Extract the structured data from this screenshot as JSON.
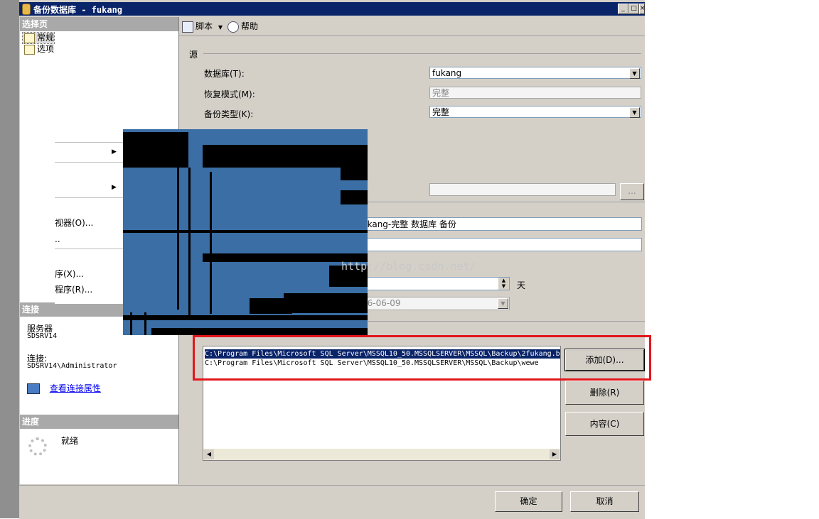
{
  "window": {
    "title": "备份数据库 - fukang",
    "btn_min": "_",
    "btn_max": "□",
    "btn_close": "×"
  },
  "left": {
    "select_page": "选择页",
    "nav": [
      {
        "label": "常规"
      },
      {
        "label": "选项"
      }
    ],
    "connection": "连接",
    "server_label": "服务器",
    "server_value": "SDSRV14",
    "conn_label": "连接:",
    "conn_value": "SDSRV14\\Administrator",
    "view_conn_props": "查看连接属性",
    "progress": "进度",
    "ready": "就绪"
  },
  "toolbar": {
    "script": "脚本",
    "help": "帮助"
  },
  "source": {
    "group": "源",
    "database_label": "数据库(T):",
    "database_value": "fukang",
    "recovery_label": "恢复模式(M):",
    "recovery_value": "完整",
    "backup_type_label": "备份类型(K):",
    "backup_type_value": "完整"
  },
  "backupset": {
    "name_value": "ukang-完整 数据库 备份",
    "days_unit": "天",
    "date_value": "16-06-09",
    "browse": "..."
  },
  "destination": {
    "paths": [
      "C:\\Program Files\\Microsoft SQL Server\\MSSQL10_50.MSSQLSERVER\\MSSQL\\Backup\\2fukang.b",
      "C:\\Program Files\\Microsoft SQL Server\\MSSQL10_50.MSSQLSERVER\\MSSQL\\Backup\\wewe"
    ],
    "add": "添加(D)...",
    "remove": "删除(R)",
    "contents": "内容(C)"
  },
  "context_menu": {
    "items": [
      "视器(O)...",
      "..",
      "序(X)...",
      "程序(R)..."
    ]
  },
  "watermark": "http://blog.csdn.net/",
  "footer": {
    "ok": "确定",
    "cancel": "取消"
  }
}
